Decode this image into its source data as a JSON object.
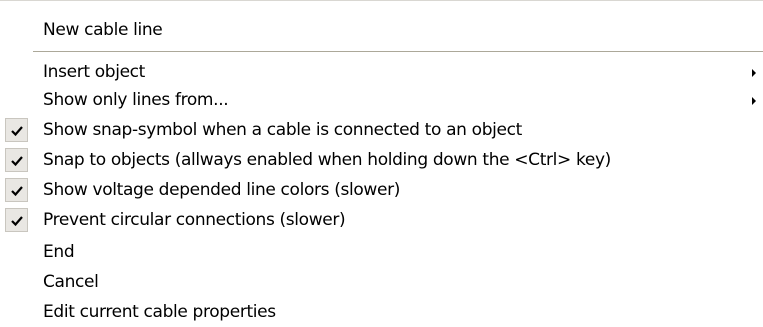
{
  "menu": {
    "items": [
      {
        "label": "New cable line",
        "checked": false,
        "has_submenu": false
      },
      {
        "label": "Insert object",
        "checked": false,
        "has_submenu": true
      },
      {
        "label": "Show only lines from...",
        "checked": false,
        "has_submenu": true
      },
      {
        "label": "Show snap-symbol when a cable is connected to an object",
        "checked": true,
        "has_submenu": false
      },
      {
        "label": "Snap to objects (allways enabled when holding down the <Ctrl> key)",
        "checked": true,
        "has_submenu": false
      },
      {
        "label": "Show voltage depended line colors (slower)",
        "checked": true,
        "has_submenu": false
      },
      {
        "label": "Prevent circular connections (slower)",
        "checked": true,
        "has_submenu": false
      },
      {
        "label": "End",
        "checked": false,
        "has_submenu": false
      },
      {
        "label": "Cancel",
        "checked": false,
        "has_submenu": false
      },
      {
        "label": "Edit current cable properties",
        "checked": false,
        "has_submenu": false
      }
    ],
    "icons": {
      "check": "checkmark-icon",
      "submenu": "submenu-arrow-icon"
    },
    "colors": {
      "background": "#ffffff",
      "text": "#000000",
      "check_box_background": "#e9e7e3",
      "separator": "#aca899"
    }
  }
}
